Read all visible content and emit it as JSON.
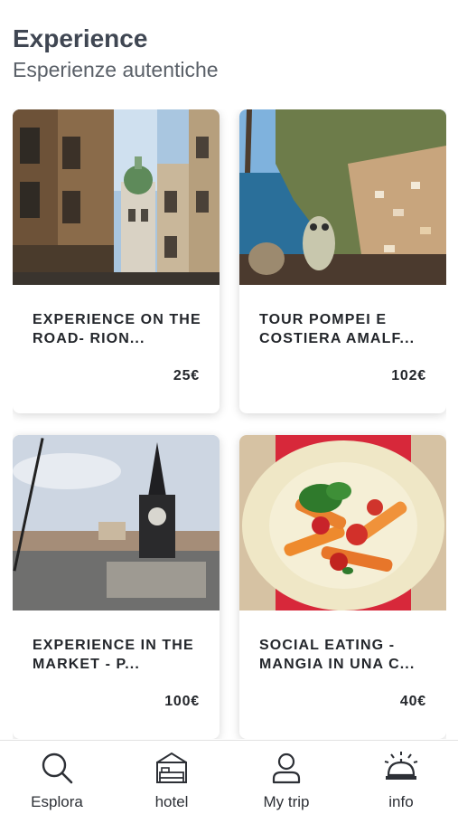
{
  "header": {
    "title": "Experience",
    "subtitle": "Esperienze autentiche"
  },
  "cards": [
    {
      "name": "EXPERIENCE ON THE ROAD- RION...",
      "price": "25€",
      "image": "naples-street-photo"
    },
    {
      "name": "TOUR POMPEI E COSTIERA AMALF...",
      "price": "102€",
      "image": "amalfi-coast-photo"
    },
    {
      "name": "EXPERIENCE IN THE MARKET - P...",
      "price": "100€",
      "image": "market-square-obelisk-photo"
    },
    {
      "name": "SOCIAL EATING - MANGIA IN UNA C...",
      "price": "40€",
      "image": "pasta-dish-photo"
    }
  ],
  "tabbar": {
    "items": [
      {
        "label": "Esplora",
        "icon": "search-icon"
      },
      {
        "label": "hotel",
        "icon": "hotel-bed-icon"
      },
      {
        "label": "My trip",
        "icon": "user-icon"
      },
      {
        "label": "info",
        "icon": "service-bell-icon"
      }
    ]
  }
}
